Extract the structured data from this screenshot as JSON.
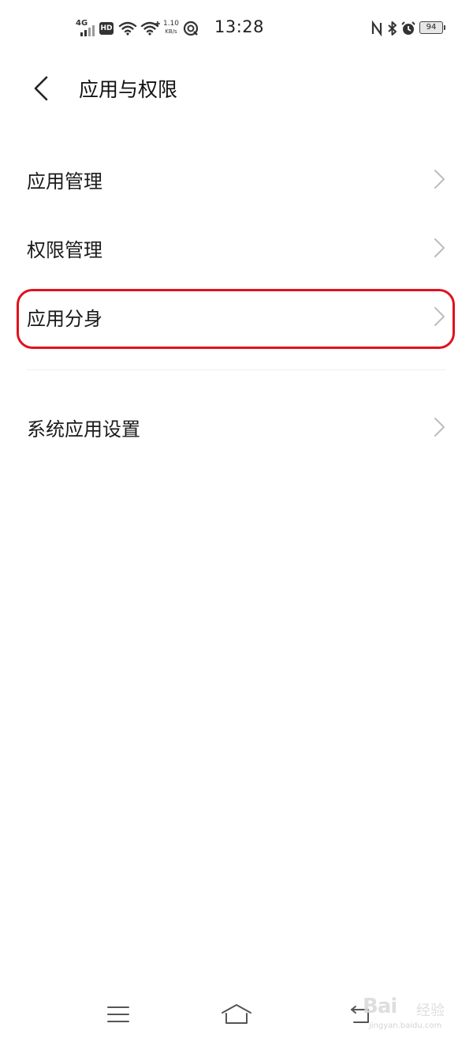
{
  "status_bar": {
    "network": "4G",
    "hd": "HD",
    "speed_value": "1.10",
    "speed_unit": "KB/s",
    "time": "13:28",
    "battery": "94",
    "icons": [
      "signal-icon",
      "hd-icon",
      "wifi-icon",
      "wifi-plus-icon",
      "qa-icon",
      "nfc-icon",
      "bluetooth-icon",
      "alarm-icon",
      "battery-icon"
    ]
  },
  "header": {
    "title": "应用与权限",
    "back_icon": "chevron-left-icon"
  },
  "list": {
    "items": [
      {
        "label": "应用管理"
      },
      {
        "label": "权限管理"
      },
      {
        "label": "应用分身"
      },
      {
        "label": "系统应用设置"
      }
    ],
    "highlighted_index": 2,
    "highlight_color": "#e0111e"
  },
  "nav_bar": {
    "icons": [
      "menu-icon",
      "home-icon",
      "back-icon"
    ]
  },
  "watermark": {
    "brand": "Bai",
    "sub": "经验",
    "url": "jingyan.baidu.com"
  }
}
